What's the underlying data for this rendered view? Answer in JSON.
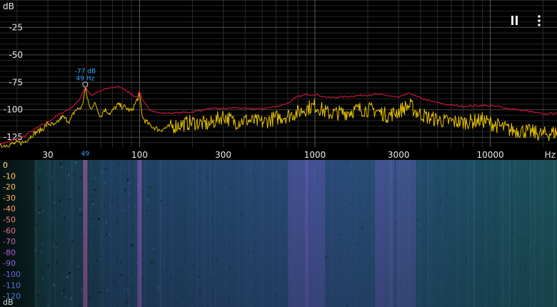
{
  "toolbar": {
    "pause_icon": "pause-icon",
    "menu_icon": "more-vert-icon"
  },
  "chart_data": [
    {
      "type": "line",
      "title": "",
      "xlabel": "Hz",
      "ylabel": "dB",
      "xscale": "log",
      "xlim": [
        16,
        24000
      ],
      "ylim": [
        -134,
        0
      ],
      "grid": true,
      "y_ticks": [
        {
          "value": -25,
          "label": "-25"
        },
        {
          "value": -50,
          "label": "-50"
        },
        {
          "value": -75,
          "label": "-75"
        },
        {
          "value": -100,
          "label": "-100"
        },
        {
          "value": -125,
          "label": "-125"
        }
      ],
      "x_ticks": [
        {
          "value": 30,
          "label": "30"
        },
        {
          "value": 100,
          "label": "100"
        },
        {
          "value": 300,
          "label": "300"
        },
        {
          "value": 1000,
          "label": "1000"
        },
        {
          "value": 3000,
          "label": "3000"
        },
        {
          "value": 10000,
          "label": "10000"
        }
      ],
      "peak_marker": {
        "freq": 49,
        "db": -77,
        "label_db": "-77 dB",
        "label_hz": "49 Hz",
        "axis_label": "49"
      },
      "series": [
        {
          "role": "peak-hold",
          "color": "#c8143c",
          "points": [
            [
              16,
              -131
            ],
            [
              18,
              -129
            ],
            [
              22,
              -124
            ],
            [
              25,
              -118
            ],
            [
              30,
              -111
            ],
            [
              35,
              -104
            ],
            [
              40,
              -99
            ],
            [
              45,
              -92
            ],
            [
              49,
              -79
            ],
            [
              53,
              -87
            ],
            [
              58,
              -84
            ],
            [
              62,
              -82
            ],
            [
              68,
              -80
            ],
            [
              75,
              -79
            ],
            [
              82,
              -81
            ],
            [
              90,
              -86
            ],
            [
              97,
              -89
            ],
            [
              100,
              -83
            ],
            [
              104,
              -92
            ],
            [
              115,
              -100
            ],
            [
              130,
              -103
            ],
            [
              160,
              -103
            ],
            [
              200,
              -102
            ],
            [
              250,
              -99
            ],
            [
              300,
              -99
            ],
            [
              350,
              -98
            ],
            [
              400,
              -99
            ],
            [
              500,
              -99
            ],
            [
              600,
              -97
            ],
            [
              700,
              -94
            ],
            [
              800,
              -88
            ],
            [
              900,
              -86
            ],
            [
              1000,
              -86
            ],
            [
              1200,
              -89
            ],
            [
              1500,
              -88
            ],
            [
              1800,
              -87
            ],
            [
              2200,
              -86
            ],
            [
              2600,
              -87
            ],
            [
              3000,
              -89
            ],
            [
              3300,
              -86
            ],
            [
              3500,
              -85
            ],
            [
              3800,
              -88
            ],
            [
              4500,
              -92
            ],
            [
              5500,
              -95
            ],
            [
              7000,
              -97
            ],
            [
              9000,
              -96
            ],
            [
              11000,
              -97
            ],
            [
              13000,
              -99
            ],
            [
              16000,
              -101
            ],
            [
              20000,
              -104
            ],
            [
              24000,
              -103
            ]
          ]
        },
        {
          "role": "live",
          "color": "#e6c200",
          "points": [
            [
              16,
              -133
            ],
            [
              18,
              -131
            ],
            [
              22,
              -129
            ],
            [
              25,
              -121
            ],
            [
              28,
              -117
            ],
            [
              30,
              -112
            ],
            [
              33,
              -114
            ],
            [
              36,
              -106
            ],
            [
              40,
              -110
            ],
            [
              43,
              -100
            ],
            [
              47,
              -97
            ],
            [
              49,
              -80
            ],
            [
              52,
              -98
            ],
            [
              56,
              -94
            ],
            [
              60,
              -106
            ],
            [
              63,
              -99
            ],
            [
              68,
              -103
            ],
            [
              75,
              -95
            ],
            [
              82,
              -97
            ],
            [
              90,
              -101
            ],
            [
              97,
              -90
            ],
            [
              100,
              -86
            ],
            [
              104,
              -107
            ],
            [
              115,
              -114
            ],
            [
              130,
              -118
            ],
            [
              160,
              -113
            ],
            [
              200,
              -110
            ],
            [
              250,
              -112
            ],
            [
              300,
              -104
            ],
            [
              350,
              -110
            ],
            [
              400,
              -108
            ],
            [
              500,
              -110
            ],
            [
              600,
              -106
            ],
            [
              700,
              -104
            ],
            [
              800,
              -101
            ],
            [
              900,
              -97
            ],
            [
              1000,
              -95
            ],
            [
              1200,
              -102
            ],
            [
              1500,
              -101
            ],
            [
              1800,
              -98
            ],
            [
              2200,
              -99
            ],
            [
              2600,
              -104
            ],
            [
              3000,
              -100
            ],
            [
              3300,
              -96
            ],
            [
              3500,
              -95
            ],
            [
              3800,
              -101
            ],
            [
              4500,
              -106
            ],
            [
              5500,
              -109
            ],
            [
              7000,
              -110
            ],
            [
              9000,
              -108
            ],
            [
              11000,
              -113
            ],
            [
              13000,
              -117
            ],
            [
              16000,
              -118
            ],
            [
              20000,
              -121
            ],
            [
              24000,
              -119
            ]
          ]
        }
      ]
    },
    {
      "type": "heatmap",
      "title": "",
      "ylabel": "dB",
      "scale_ticks": [
        {
          "value": 0,
          "label": "0",
          "color": "#ffe56a"
        },
        {
          "value": -10,
          "label": "-10",
          "color": "#ffd24a"
        },
        {
          "value": -20,
          "label": "-20",
          "color": "#ffbf55"
        },
        {
          "value": -30,
          "label": "-30",
          "color": "#ffad5a"
        },
        {
          "value": -40,
          "label": "-40",
          "color": "#ff9c63"
        },
        {
          "value": -50,
          "label": "-50",
          "color": "#f27e78"
        },
        {
          "value": -60,
          "label": "-60",
          "color": "#e06a93"
        },
        {
          "value": -70,
          "label": "-70",
          "color": "#c663b5"
        },
        {
          "value": -80,
          "label": "-80",
          "color": "#a461cc"
        },
        {
          "value": -90,
          "label": "-90",
          "color": "#8463d6"
        },
        {
          "value": -100,
          "label": "-100",
          "color": "#6a68d6"
        },
        {
          "value": -110,
          "label": "-110",
          "color": "#5a72cf"
        },
        {
          "value": -120,
          "label": "-120",
          "color": "#4e7fc4"
        }
      ],
      "bands": [
        {
          "freq": 49,
          "level": -72
        },
        {
          "freq": 100,
          "level": -80
        },
        {
          "freq": 800,
          "level": -88
        },
        {
          "freq": 1000,
          "level": -86
        },
        {
          "freq": 2500,
          "level": -90
        },
        {
          "freq": 3300,
          "level": -92
        }
      ]
    }
  ]
}
